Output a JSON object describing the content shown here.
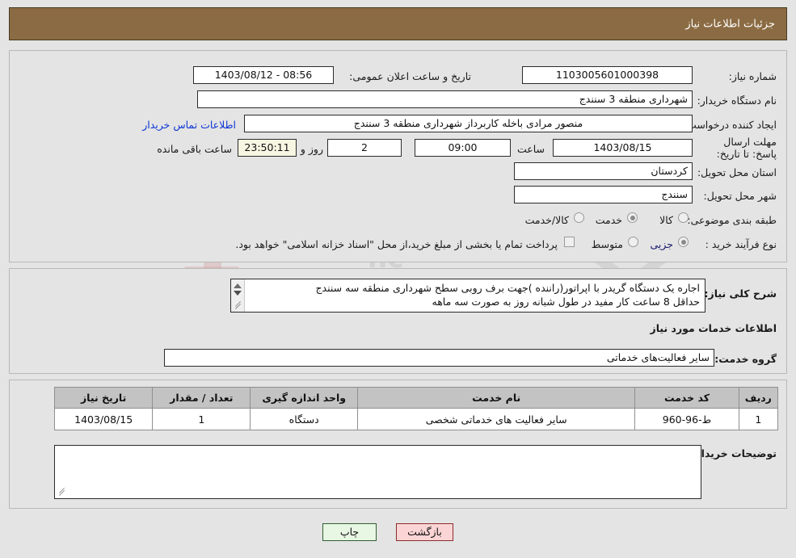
{
  "header": {
    "title": "جزئیات اطلاعات نیاز"
  },
  "top_section": {
    "need_number_label": "شماره نیاز:",
    "need_number_value": "1103005601000398",
    "announce_datetime_label": "تاریخ و ساعت اعلان عمومی:",
    "announce_datetime_value": "08:56 - 1403/08/12",
    "buyer_org_label": "نام دستگاه خریدار:",
    "buyer_org_value": "شهرداری منطقه 3 سنندج",
    "requester_label": "ایجاد کننده درخواست:",
    "requester_value": "منصور مرادی باخله کاربرداز شهرداری منطقه 3 سنندج",
    "buyer_contact_link": "اطلاعات تماس خریدار",
    "deadline_label": "مهلت ارسال پاسخ: تا تاریخ:",
    "deadline_date": "1403/08/15",
    "hour_label": "ساعت",
    "deadline_time": "09:00",
    "days_remaining": "2",
    "days_separator_label": "روز و",
    "time_remaining": "23:50:11",
    "remaining_suffix_label": "ساعت باقی مانده",
    "province_label": "استان محل تحویل:",
    "province_value": "کردستان",
    "city_label": "شهر محل تحویل:",
    "city_value": "سنندج",
    "category_label": "طبقه بندی موضوعی:",
    "category_options": [
      "کالا",
      "خدمت",
      "کالا/خدمت"
    ],
    "category_selected_index": 1,
    "process_type_label": "نوع فرآیند خرید :",
    "process_options": [
      "جزیی",
      "متوسط"
    ],
    "process_selected_index": 0,
    "treasury_checkbox_checked": false,
    "treasury_note": "پرداخت تمام یا بخشی از مبلغ خرید،از محل \"اسناد خزانه اسلامی\" خواهد بود."
  },
  "description_section": {
    "need_description_label": "شرح کلی نیاز:",
    "need_description_value": "اجاره یک دستگاه گریدر با اپراتور(راننده )جهت برف روبی سطح شهرداری منطقه سه سنندج\nحداقل 8 ساعت کار مفید در طول شبانه روز به صورت سه ماهه",
    "services_heading": "اطلاعات خدمات مورد نیاز",
    "service_group_label": "گروه خدمت:",
    "service_group_value": "سایر فعالیت‌های خدماتی"
  },
  "table": {
    "columns": [
      "ردیف",
      "کد خدمت",
      "نام خدمت",
      "واحد اندازه گیری",
      "تعداد / مقدار",
      "تاریخ نیاز"
    ],
    "rows": [
      {
        "row_no": "1",
        "service_code": "ط-96-960",
        "service_name": "سایر فعالیت های خدماتی شخصی",
        "unit": "دستگاه",
        "quantity": "1",
        "need_date": "1403/08/15"
      }
    ]
  },
  "buyer_notes": {
    "label": "توضیحات خریدار:",
    "value": ""
  },
  "footer": {
    "print_label": "چاپ",
    "back_label": "بازگشت"
  },
  "watermark": {
    "main_text": "AriaTender.net",
    "secondary_text": "nc"
  },
  "colors": {
    "header_bg": "#8b6b43",
    "page_bg": "#e4e4e4",
    "link": "#0d36d6",
    "countdown_bg": "#f7f6e2",
    "back_button_bg": "#fbd5d5",
    "print_button_bg": "#e8f6e4",
    "table_header_bg": "#c3c3c3"
  }
}
